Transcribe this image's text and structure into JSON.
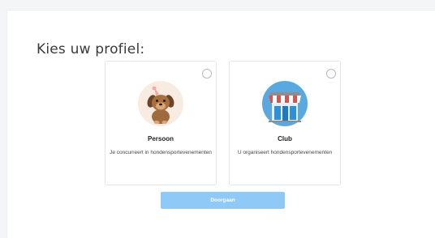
{
  "title": "Kies uw profiel:",
  "profiles": [
    {
      "name": "Persoon",
      "description": "Je concurreert in hondensportevenementen",
      "icon": "dog-icon",
      "selected": false
    },
    {
      "name": "Club",
      "description": "U organiseert hondensportevenementen",
      "icon": "storefront-icon",
      "selected": false
    }
  ],
  "continue_label": "Doorgaan",
  "colors": {
    "button": "#8fc9f8",
    "persoon_circle": "#f8ebe2",
    "club_circle": "#5aa8e0",
    "awning_red": "#d9534f"
  }
}
